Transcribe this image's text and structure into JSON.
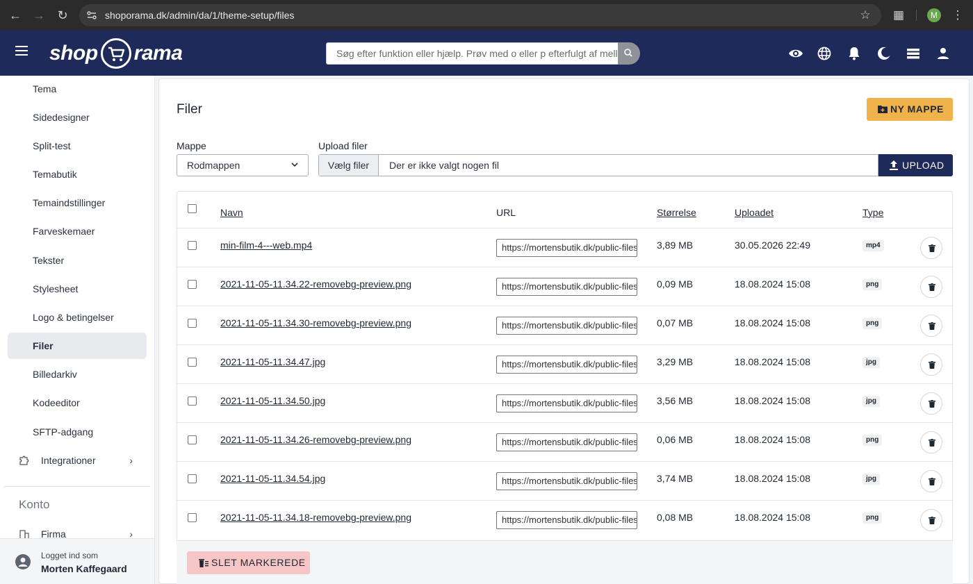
{
  "browser": {
    "url": "shoporama.dk/admin/da/1/theme-setup/files",
    "profile_initial": "M"
  },
  "header": {
    "logo_left": "shop",
    "logo_right": "rama",
    "search_placeholder": "Søg efter funktion eller hjælp. Prøv med o eller p efterfulgt af mellemrum"
  },
  "sidebar": {
    "items": [
      {
        "label": "Tema"
      },
      {
        "label": "Sidedesigner"
      },
      {
        "label": "Split-test"
      },
      {
        "label": "Temabutik"
      },
      {
        "label": "Temaindstillinger"
      },
      {
        "label": "Farveskemaer"
      },
      {
        "label": "Tekster"
      },
      {
        "label": "Stylesheet"
      },
      {
        "label": "Logo & betingelser"
      },
      {
        "label": "Filer"
      },
      {
        "label": "Billedarkiv"
      },
      {
        "label": "Kodeeditor"
      },
      {
        "label": "SFTP-adgang"
      }
    ],
    "integrations_label": "Integrationer",
    "section_title": "Konto",
    "company_label": "Firma",
    "logged_in_label": "Logget ind som",
    "user_name": "Morten Kaffegaard"
  },
  "main": {
    "title": "Filer",
    "new_folder_label": "NY MAPPE",
    "folder_label": "Mappe",
    "folder_value": "Rodmappen",
    "upload_label": "Upload filer",
    "choose_files_label": "Vælg filer",
    "no_file_text": "Der er ikke valgt nogen fil",
    "upload_button": "UPLOAD",
    "columns": {
      "name": "Navn",
      "url": "URL",
      "size": "Størrelse",
      "uploaded": "Uploadet",
      "type": "Type"
    },
    "url_prefix": "https://mortensbutik.dk/public-files/",
    "files": [
      {
        "name": "min-film-4---web.mp4",
        "size": "3,89 MB",
        "uploaded": "30.05.2026 22:49",
        "type": "mp4"
      },
      {
        "name": "2021-11-05-11.34.22-removebg-preview.png",
        "size": "0,09 MB",
        "uploaded": "18.08.2024 15:08",
        "type": "png"
      },
      {
        "name": "2021-11-05-11.34.30-removebg-preview.png",
        "size": "0,07 MB",
        "uploaded": "18.08.2024 15:08",
        "type": "png"
      },
      {
        "name": "2021-11-05-11.34.47.jpg",
        "size": "3,29 MB",
        "uploaded": "18.08.2024 15:08",
        "type": "jpg"
      },
      {
        "name": "2021-11-05-11.34.50.jpg",
        "size": "3,56 MB",
        "uploaded": "18.08.2024 15:08",
        "type": "jpg"
      },
      {
        "name": "2021-11-05-11.34.26-removebg-preview.png",
        "size": "0,06 MB",
        "uploaded": "18.08.2024 15:08",
        "type": "png"
      },
      {
        "name": "2021-11-05-11.34.54.jpg",
        "size": "3,74 MB",
        "uploaded": "18.08.2024 15:08",
        "type": "jpg"
      },
      {
        "name": "2021-11-05-11.34.18-removebg-preview.png",
        "size": "0,08 MB",
        "uploaded": "18.08.2024 15:08",
        "type": "png"
      }
    ],
    "delete_marked_label": "SLET MARKEREDE"
  },
  "colors": {
    "brand_navy": "#1e2a5a",
    "accent_orange": "#f0b24a",
    "danger_soft": "#f6c6c6"
  }
}
